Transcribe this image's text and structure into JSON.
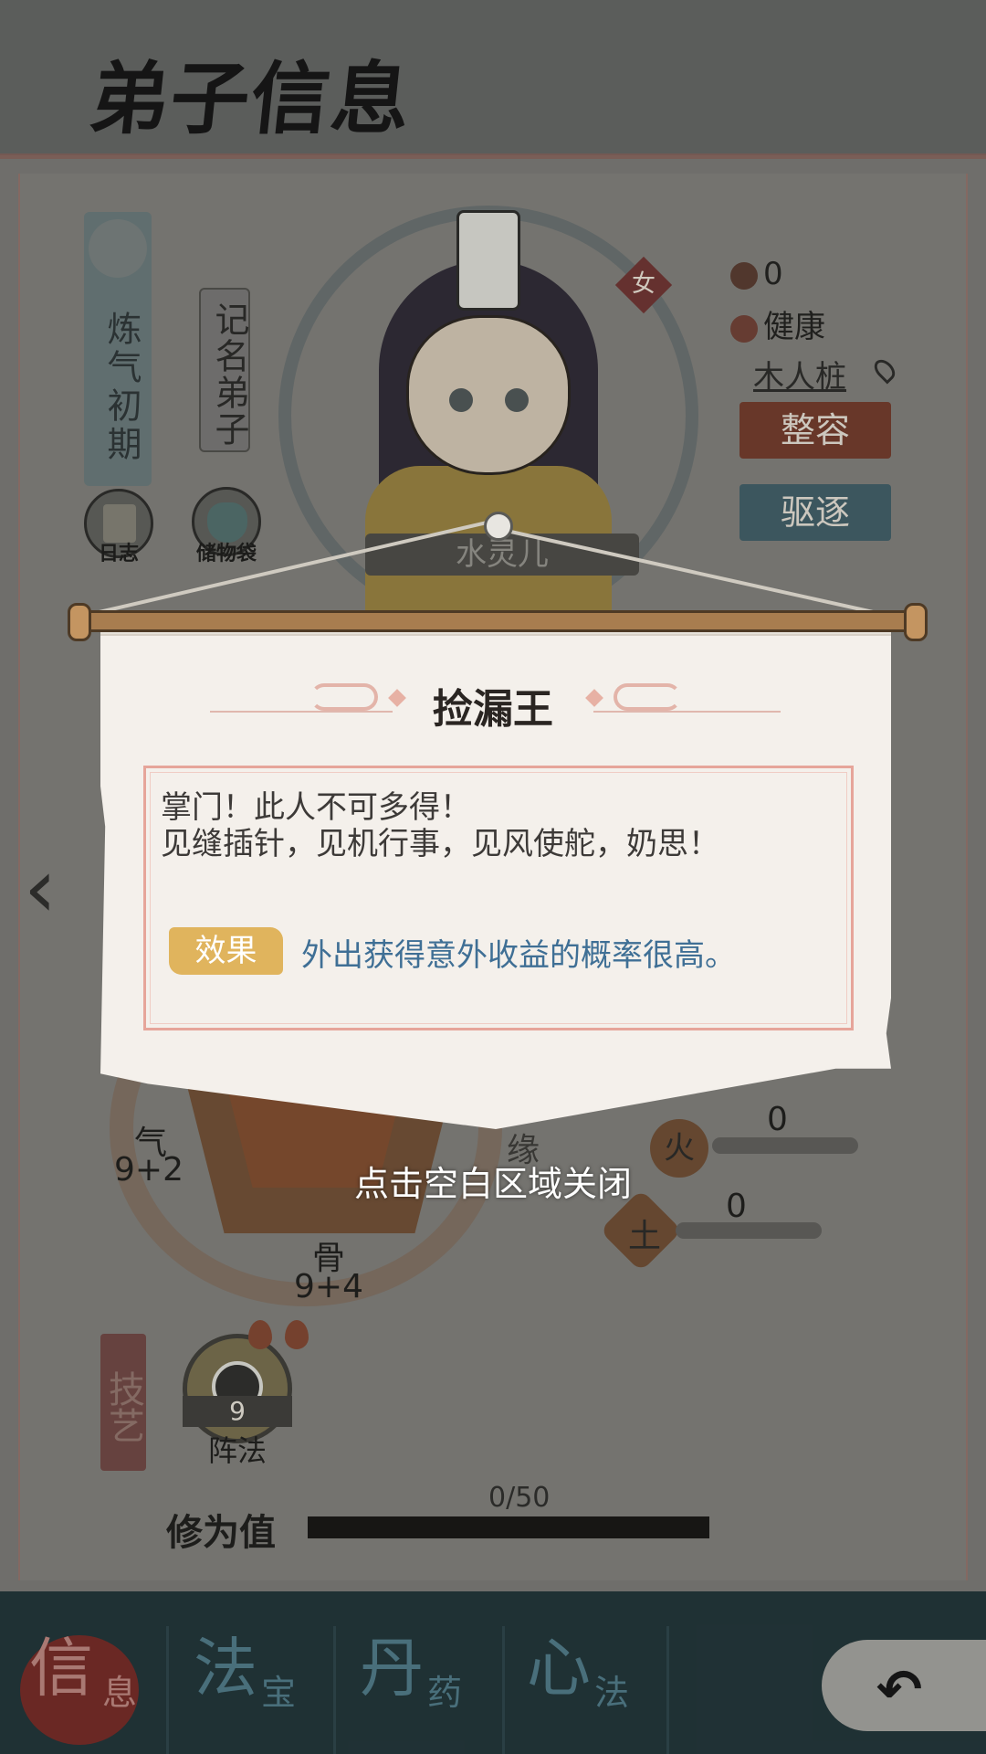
{
  "page": {
    "title": "弟子信息"
  },
  "disciple": {
    "realm": "炼气初期",
    "rank": "记名弟子",
    "name": "水灵儿",
    "gender": "女",
    "stat_value": "0",
    "health": "健康",
    "location": "木人桩"
  },
  "buttons": {
    "journal": "日志",
    "storage": "储物袋",
    "makeover": "整容",
    "expel": "驱逐"
  },
  "attributes": {
    "qi_label": "气",
    "qi_value": "9+2",
    "bone_label": "骨",
    "bone_value": "9+4",
    "fate_label": "缘"
  },
  "elements": [
    {
      "icon": "火",
      "value": "0"
    },
    {
      "icon": "土",
      "value": "0"
    }
  ],
  "skills": {
    "tab_label": "技艺",
    "items": [
      {
        "name": "阵法",
        "level": "9"
      }
    ]
  },
  "cultivation": {
    "label": "修为值",
    "progress_text": "0/50",
    "progress": 0
  },
  "nav": {
    "tabs": [
      {
        "big": "信",
        "small": "息"
      },
      {
        "big": "法",
        "small": "宝"
      },
      {
        "big": "丹",
        "small": "药"
      },
      {
        "big": "心",
        "small": "法"
      }
    ],
    "active_index": 0
  },
  "dialog": {
    "title": "捡漏王",
    "desc_line1": "掌门！此人不可多得！",
    "desc_line2": "见缝插针，见机行事，见风使舵，奶思！",
    "effect_label": "效果",
    "effect_text": "外出获得意外收益的概率很高。",
    "close_hint": "点击空白区域关闭"
  },
  "colors": {
    "accent_red": "#6f2a26",
    "effect_tag": "#e0b45d",
    "effect_text": "#3f6f95",
    "nav_bg": "#213337"
  },
  "icons": [
    "cloud-icon",
    "scroll-book-icon",
    "storage-bag-icon",
    "location-pin-icon",
    "heart-icon",
    "chevron-left-icon",
    "yin-yang-icon",
    "flame-icon",
    "back-arrow-icon"
  ]
}
